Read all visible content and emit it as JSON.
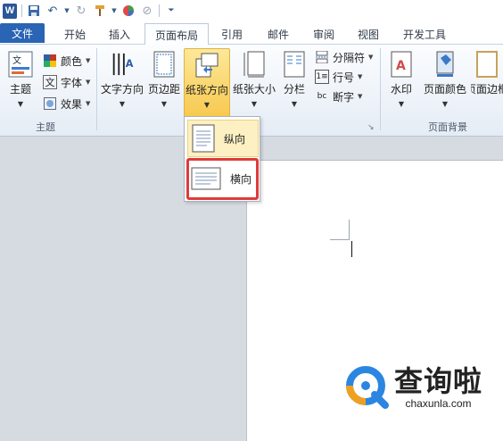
{
  "app": {
    "logo_letter": "W"
  },
  "colors": {
    "file_tab": "#2a64b4",
    "highlight": "#f7c94f",
    "callout_border": "#e03a3a",
    "watermark_blue": "#2a86e0",
    "watermark_orange": "#f0a020"
  },
  "quick_access": {
    "icons": [
      "word-logo-icon",
      "save-icon",
      "undo-icon",
      "redo-icon",
      "format-painter-icon",
      "color-icon",
      "clear-format-icon",
      "customize-icon"
    ]
  },
  "tabs": [
    "文件",
    "开始",
    "插入",
    "页面布局",
    "引用",
    "邮件",
    "审阅",
    "视图",
    "开发工具"
  ],
  "active_tab": "页面布局",
  "ribbon": {
    "theme_group": {
      "label": "主题",
      "theme_button": "主题",
      "colors": "颜色",
      "fonts": "字体",
      "effects": "效果"
    },
    "page_setup": {
      "text_direction": "文字方向",
      "margins": "页边距",
      "orientation": "纸张方向",
      "size": "纸张大小",
      "columns": "分栏",
      "breaks": "分隔符",
      "line_numbers": "行号",
      "hyphenation": "断字"
    },
    "page_background": {
      "label": "页面背景",
      "watermark": "水印",
      "page_color": "页面颜色",
      "page_borders": "页面边框"
    }
  },
  "orientation_menu": {
    "portrait": "纵向",
    "landscape": "横向",
    "selected": "横向"
  },
  "watermark": {
    "chinese": "查询啦",
    "domain": "chaxunla.com"
  }
}
